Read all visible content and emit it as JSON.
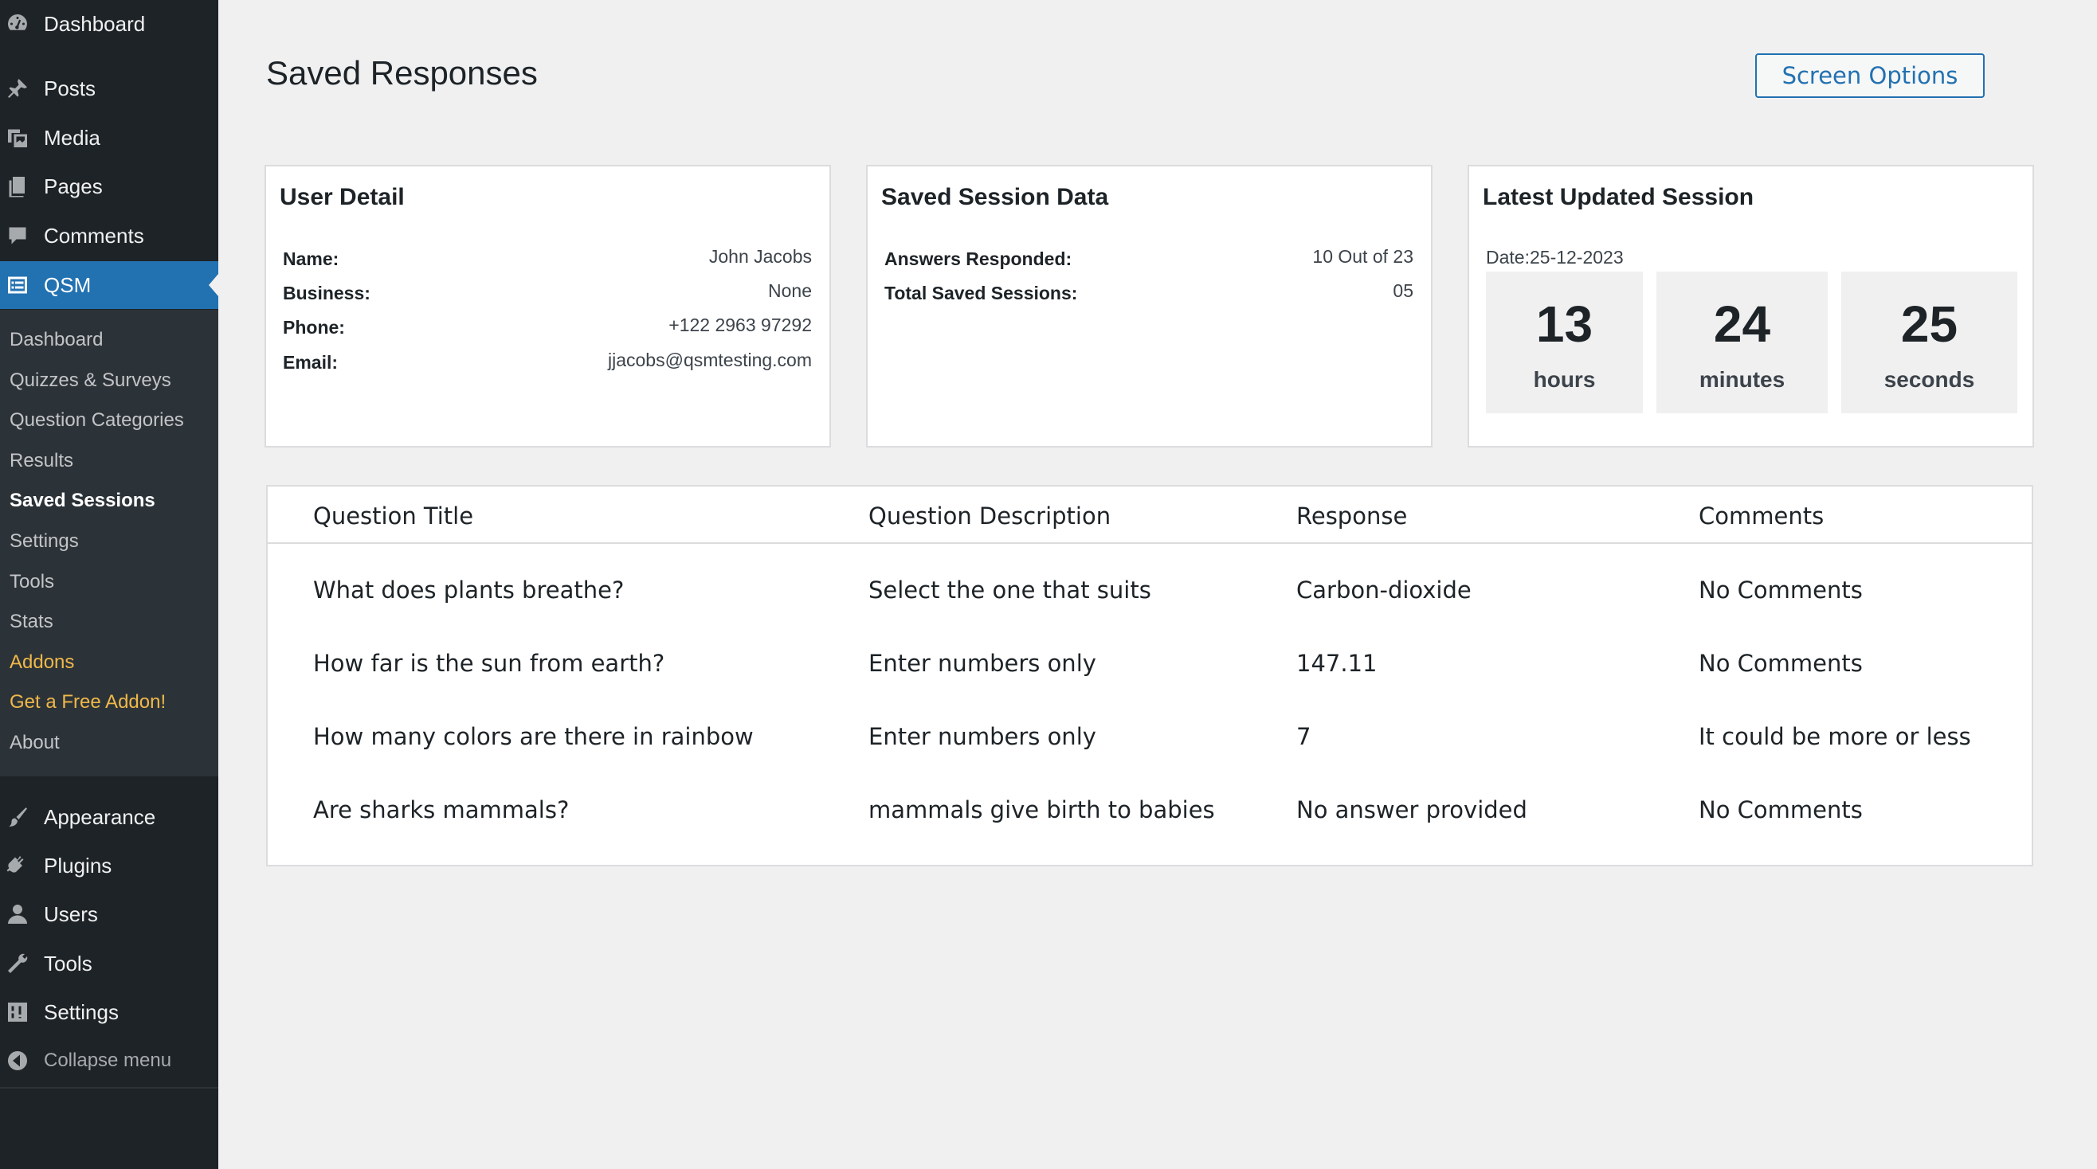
{
  "sidebar": {
    "top_items": [
      {
        "label": "Dashboard",
        "icon": "dashboard-icon"
      },
      {
        "label": "Posts",
        "icon": "pin-icon"
      },
      {
        "label": "Media",
        "icon": "media-icon"
      },
      {
        "label": "Pages",
        "icon": "pages-icon"
      },
      {
        "label": "Comments",
        "icon": "comment-icon"
      },
      {
        "label": "QSM",
        "icon": "qsm-icon"
      }
    ],
    "submenu": [
      {
        "label": "Dashboard"
      },
      {
        "label": "Quizzes & Surveys"
      },
      {
        "label": "Question Categories"
      },
      {
        "label": "Results"
      },
      {
        "label": "Saved Sessions"
      },
      {
        "label": "Settings"
      },
      {
        "label": "Tools"
      },
      {
        "label": "Stats"
      },
      {
        "label": "Addons"
      },
      {
        "label": "Get a Free Addon!"
      },
      {
        "label": "About"
      }
    ],
    "bottom_items": [
      {
        "label": "Appearance",
        "icon": "brush-icon"
      },
      {
        "label": "Plugins",
        "icon": "plugin-icon"
      },
      {
        "label": "Users",
        "icon": "user-icon"
      },
      {
        "label": "Tools",
        "icon": "wrench-icon"
      },
      {
        "label": "Settings",
        "icon": "settings-icon"
      }
    ],
    "collapse_label": "Collapse menu",
    "accent_color": "#2271b1",
    "addon_color": "#f0b849"
  },
  "header": {
    "title": "Saved Responses",
    "screen_options_label": "Screen Options"
  },
  "user_detail": {
    "title": "User Detail",
    "rows": [
      {
        "label": "Name:",
        "value": "John Jacobs"
      },
      {
        "label": "Business:",
        "value": "None"
      },
      {
        "label": "Phone:",
        "value": "+122 2963 97292"
      },
      {
        "label": "Email:",
        "value": "jjacobs@qsmtesting.com"
      }
    ]
  },
  "session_data": {
    "title": "Saved Session Data",
    "rows": [
      {
        "label": "Answers Responded:",
        "value": "10 Out of 23"
      },
      {
        "label": "Total Saved Sessions:",
        "value": "05"
      }
    ]
  },
  "latest_session": {
    "title": "Latest Updated Session",
    "date_label": "Date:",
    "date_value": "25-12-2023",
    "timer": [
      {
        "value": "13",
        "unit": "hours"
      },
      {
        "value": "24",
        "unit": "minutes"
      },
      {
        "value": "25",
        "unit": "seconds"
      }
    ]
  },
  "table": {
    "headers": [
      "Question Title",
      "Question Description",
      "Response",
      "Comments"
    ],
    "rows": [
      [
        "What does plants breathe?",
        "Select the one that suits",
        "Carbon-dioxide",
        "No Comments"
      ],
      [
        "How far is the sun from earth?",
        "Enter numbers only",
        "147.11",
        "No Comments"
      ],
      [
        "How many colors are there in rainbow",
        "Enter numbers only",
        "7",
        "It could be more or less"
      ],
      [
        "Are sharks mammals?",
        "mammals give birth to babies",
        "No answer provided",
        "No Comments"
      ]
    ]
  }
}
